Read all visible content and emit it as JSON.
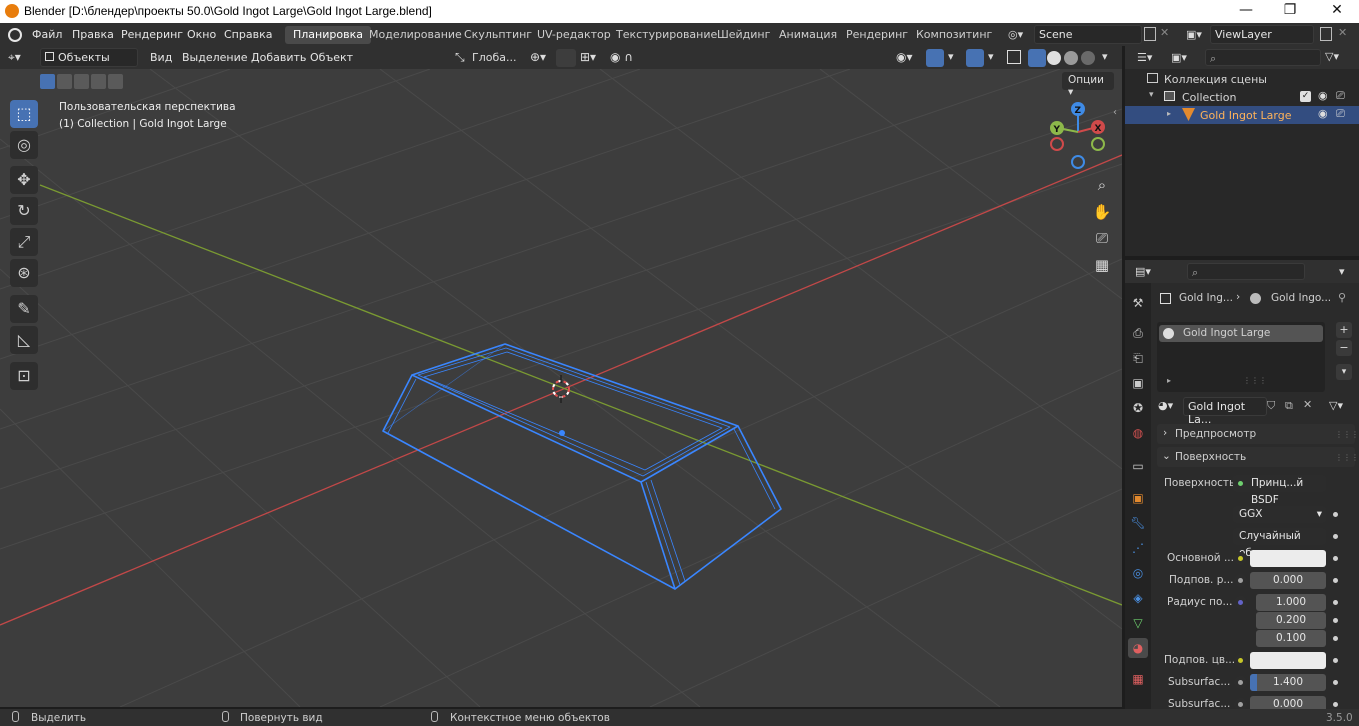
{
  "window": {
    "title": "Blender [D:\\блендер\\проекты 50.0\\Gold Ingot Large\\Gold Ingot Large.blend]",
    "minimize": "—",
    "maximize": "❐",
    "close": "✕"
  },
  "menu": [
    "Файл",
    "Правка",
    "Рендеринг",
    "Окно",
    "Справка"
  ],
  "workspaces": [
    "Планировка",
    "Моделирование",
    "Скульптинг",
    "UV-редактор",
    "Текстурирование",
    "Шейдинг",
    "Анимация",
    "Рендеринг",
    "Композитинг"
  ],
  "active_workspace": "Планировка",
  "scene": {
    "name": "Scene",
    "view_layer": "ViewLayer"
  },
  "viewport_header": {
    "mode": "Объекты",
    "menus": [
      "Вид",
      "Выделение",
      "Добавить",
      "Объект"
    ],
    "transform_orientation": "Глоба...",
    "options": "Опции"
  },
  "viewport": {
    "view_name": "Пользовательская перспектива",
    "view_context": "(1) Collection | Gold Ingot Large",
    "gizmo_axes": [
      "X",
      "Y",
      "Z"
    ],
    "tools": [
      "select-box-icon",
      "cursor-icon",
      "move-icon",
      "rotate-icon",
      "scale-icon",
      "transform-icon",
      "annotate-icon",
      "measure-icon",
      "add-cube-icon"
    ]
  },
  "outliner": {
    "scene_collection": "Коллекция сцены",
    "collection": "Collection",
    "object": "Gold Ingot Large"
  },
  "properties": {
    "breadcrumb_object": "Gold Ing...",
    "breadcrumb_material": "Gold Ingo...",
    "material_slot": "Gold Ingot Large",
    "material_name": "Gold Ingot La...",
    "panel_preview": "Предпросмотр",
    "panel_surface": "Поверхность",
    "surface_label": "Поверхность",
    "surface_value": "Принц...й BSDF",
    "distribution": "GGX",
    "subsurface_method": "Случайный об...",
    "rows": [
      {
        "label": "Основной ...",
        "value": "",
        "kind": "color"
      },
      {
        "label": "Подпов. р...",
        "value": "0.000",
        "kind": "num"
      },
      {
        "label": "Радиус по...",
        "value": "1.000",
        "kind": "num"
      },
      {
        "label": "",
        "value": "0.200",
        "kind": "num"
      },
      {
        "label": "",
        "value": "0.100",
        "kind": "num"
      },
      {
        "label": "Подпов. цв...",
        "value": "",
        "kind": "color"
      },
      {
        "label": "Subsurfac...",
        "value": "1.400",
        "kind": "num"
      },
      {
        "label": "Subsurfac...",
        "value": "0.000",
        "kind": "num"
      }
    ]
  },
  "statusbar": {
    "select": "Выделить",
    "rotate_view": "Повернуть вид",
    "context_menu": "Контекстное меню объектов",
    "version": "3.5.0"
  },
  "colors": {
    "accent": "#4772b3",
    "selection_outline": "#3a86ff",
    "axis_x": "#d04a4a",
    "axis_y": "#8db84a",
    "axis_z": "#3f8be6",
    "bg_viewport": "#3d3d3d"
  }
}
